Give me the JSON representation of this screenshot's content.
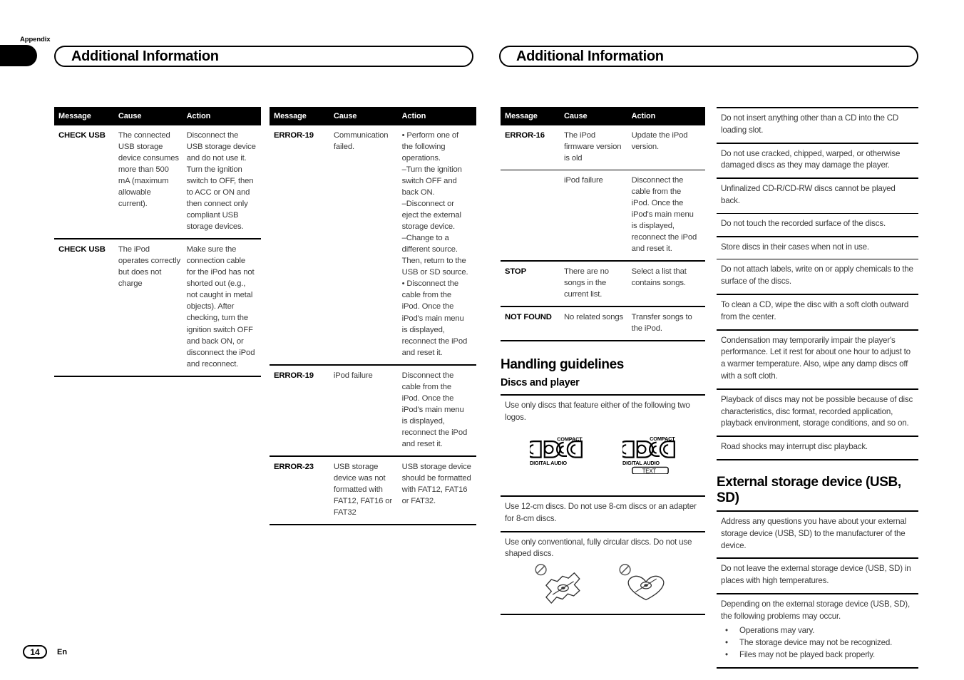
{
  "document": {
    "side_tab_label": "Appendix",
    "page_number": "14",
    "language_code": "En"
  },
  "headers": {
    "left": "Additional Information",
    "right": "Additional Information"
  },
  "table_columns": {
    "message": "Message",
    "cause": "Cause",
    "action": "Action"
  },
  "table1": {
    "rows": [
      {
        "message": "CHECK USB",
        "cause": "The connected USB storage device consumes more than 500 mA (maximum allowable current).",
        "action": "Disconnect the USB storage device and do not use it. Turn the ignition switch to OFF, then to ACC or ON and then connect only compliant USB storage devices."
      },
      {
        "message": "CHECK USB",
        "cause": "The iPod operates correctly but does not charge",
        "action": "Make sure the connection cable for the iPod has not shorted out (e.g., not caught in metal objects). After checking, turn the ignition switch OFF and back ON, or disconnect the iPod and reconnect."
      }
    ]
  },
  "table2": {
    "rows": [
      {
        "message": "ERROR-19",
        "cause": "Communication failed.",
        "action": "• Perform one of the following operations.\n–Turn the ignition switch OFF and back ON.\n–Disconnect or eject the external storage device.\n–Change to a different source. Then, return to the USB or SD source.\n• Disconnect the cable from the iPod. Once the iPod's main menu is displayed, reconnect the iPod and reset it."
      },
      {
        "message": "ERROR-19",
        "cause": "iPod failure",
        "action": "Disconnect the cable from the iPod. Once the iPod's main menu is displayed, reconnect the iPod and reset it."
      },
      {
        "message": "ERROR-23",
        "cause": "USB storage device was not formatted with FAT12, FAT16 or FAT32",
        "action": "USB storage device should be formatted with FAT12, FAT16 or FAT32."
      }
    ]
  },
  "table3": {
    "rows": [
      {
        "message": "ERROR-16",
        "cause": "The iPod firmware version is old",
        "action": "Update the iPod version.",
        "divider": "thin"
      },
      {
        "message": "",
        "cause": "iPod failure",
        "action": "Disconnect the cable from the iPod. Once the iPod's main menu is displayed, reconnect the iPod and reset it.",
        "divider": "thick"
      },
      {
        "message": "STOP",
        "cause": "There are no songs in the current list.",
        "action": "Select a list that contains songs.",
        "divider": "thick"
      },
      {
        "message": "NOT FOUND",
        "cause": "No related songs",
        "action": "Transfer songs to the iPod.",
        "divider": "thick"
      }
    ]
  },
  "handling": {
    "title": "Handling guidelines",
    "discs_subtitle": "Discs and player",
    "intro": "Use only discs that feature either of the following two logos.",
    "logos": [
      {
        "name": "compact-disc-digital-audio",
        "top": "COMPACT",
        "word": "disc",
        "bottom": "DIGITAL AUDIO",
        "extra": ""
      },
      {
        "name": "compact-disc-digital-audio-text",
        "top": "COMPACT",
        "word": "disc",
        "bottom": "DIGITAL AUDIO",
        "extra": "TEXT"
      }
    ],
    "note_12cm": "Use 12-cm discs. Do not use 8-cm discs or an adapter for 8-cm discs.",
    "note_shaped": "Use only conventional, fully circular discs. Do not use shaped discs."
  },
  "disc_notes": [
    "Do not insert anything other than a CD into the CD loading slot.",
    "Do not use cracked, chipped, warped, or otherwise damaged discs as they may damage the player.",
    "Unfinalized CD-R/CD-RW discs cannot be played back.",
    "Do not touch the recorded surface of the discs.",
    "Store discs in their cases when not in use.",
    "Do not attach labels, write on or apply chemicals to the surface of the discs.",
    "To clean a CD, wipe the disc with a soft cloth outward from the center.",
    "Condensation may temporarily impair the player's performance. Let it rest for about one hour to adjust to a warmer temperature. Also, wipe any damp discs off with a soft cloth.",
    "Playback of discs may not be possible because of disc characteristics, disc format, recorded application, playback environment, storage conditions, and so on.",
    "Road shocks may interrupt disc playback."
  ],
  "external_storage": {
    "title": "External storage device (USB, SD)",
    "notes": [
      "Address any questions you have about your external storage device (USB, SD) to the manufacturer of the device.",
      "Do not leave the external storage device (USB, SD) in places with high temperatures."
    ],
    "problems_intro": "Depending on the external storage device (USB, SD), the following problems may occur.",
    "problems": [
      "Operations may vary.",
      "The storage device may not be recognized.",
      "Files may not be played back properly."
    ]
  }
}
